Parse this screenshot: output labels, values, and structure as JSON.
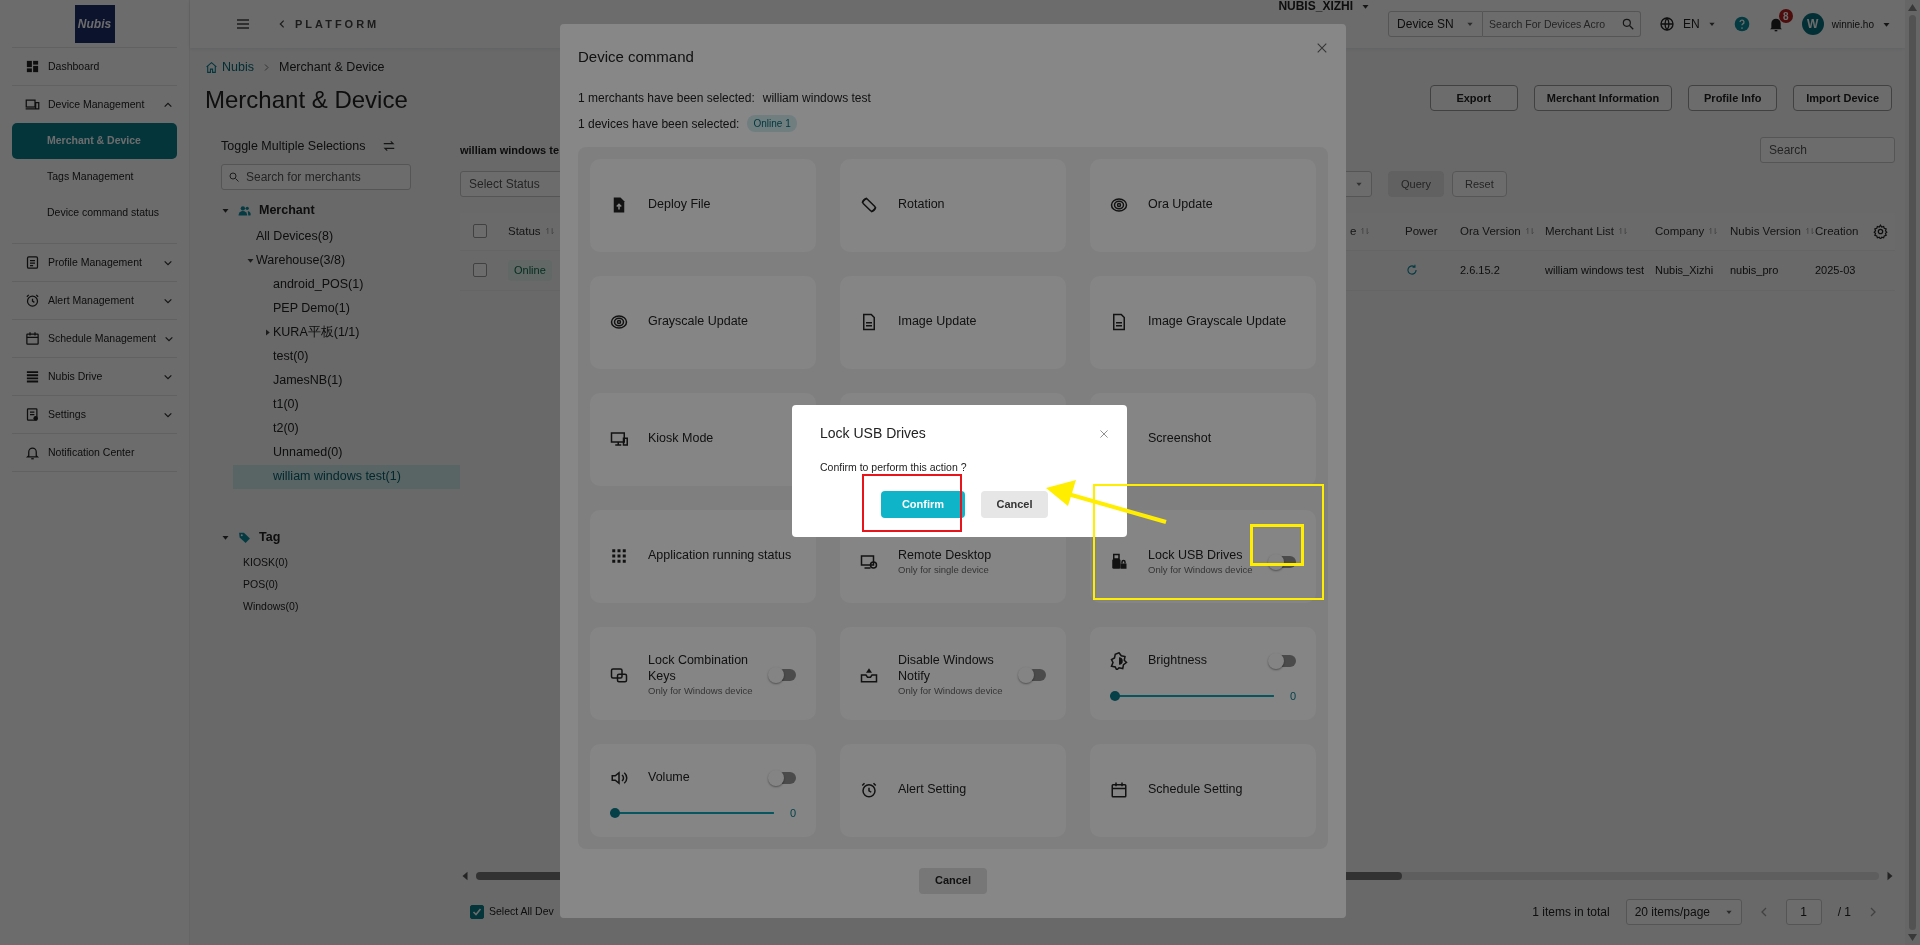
{
  "sidebar": {
    "logo": "Nubis",
    "items": [
      {
        "label": "Dashboard"
      },
      {
        "label": "Device Management",
        "expanded": true,
        "children": [
          {
            "label": "Merchant & Device",
            "selected": true
          },
          {
            "label": "Tags Management",
            "selected": false
          },
          {
            "label": "Device command status",
            "selected": false
          }
        ]
      },
      {
        "label": "Profile Management",
        "expanded": false
      },
      {
        "label": "Alert Management",
        "expanded": false
      },
      {
        "label": "Schedule Management",
        "expanded": false
      },
      {
        "label": "Nubis Drive",
        "expanded": false
      },
      {
        "label": "Settings",
        "expanded": false
      },
      {
        "label": "Notification Center"
      }
    ]
  },
  "header": {
    "platform": "PLATFORM",
    "merchant": "NUBIS_XIZHI",
    "search_type": "Device SN",
    "search_placeholder": "Search For Devices Acro",
    "language": "EN",
    "notification_count": "8",
    "avatar": "W",
    "user": "winnie.ho"
  },
  "breadcrumb": [
    "Nubis",
    "Merchant & Device"
  ],
  "page_title": "Merchant & Device",
  "actions": [
    "Export",
    "Merchant Information",
    "Profile Info",
    "Import Device"
  ],
  "tree_panel": {
    "toggle_label": "Toggle Multiple Selections",
    "search_placeholder": "Search for merchants",
    "groups": [
      {
        "kind": "merchant",
        "label": "Merchant",
        "expanded": true,
        "children": [
          {
            "label": "All Devices(8)",
            "selected": false
          },
          {
            "label": "Warehouse(3/8)",
            "selected": false,
            "expanded": true,
            "children": [
              {
                "label": "android_POS(1)",
                "selected": false
              },
              {
                "label": "PEP Demo(1)",
                "selected": false
              },
              {
                "label": "KURA平板(1/1)",
                "selected": false,
                "expanded": false
              },
              {
                "label": "test(0)",
                "selected": false
              },
              {
                "label": "JamesNB(1)",
                "selected": false
              },
              {
                "label": "t1(0)",
                "selected": false
              },
              {
                "label": "t2(0)",
                "selected": false
              },
              {
                "label": "Unnamed(0)",
                "selected": false
              },
              {
                "label": "william windows test(1)",
                "selected": true
              }
            ]
          }
        ]
      },
      {
        "kind": "tag",
        "label": "Tag",
        "expanded": true,
        "children": [
          {
            "label": "KIOSK(0)",
            "selected": false
          },
          {
            "label": "POS(0)",
            "selected": false
          },
          {
            "label": "Windows(0)",
            "selected": false
          }
        ]
      }
    ]
  },
  "device_list": {
    "title": "william windows te",
    "search_placeholder": "Search",
    "status_placeholder": "Select Status",
    "buttons": [
      {
        "label": "Query",
        "kind": "filled"
      },
      {
        "label": "Reset",
        "kind": "outline"
      }
    ],
    "table": {
      "header_checked": false,
      "columns": [
        {
          "label": "Status",
          "sortable": true
        },
        {
          "label": "e",
          "sortable": true
        },
        {
          "label": "Power",
          "sortable": false
        },
        {
          "label": "Ora Version",
          "sortable": true
        },
        {
          "label": "Merchant List",
          "sortable": true
        },
        {
          "label": "Company",
          "sortable": true
        },
        {
          "label": "Nubis Version",
          "sortable": true
        },
        {
          "label": "Creation",
          "sortable": false
        }
      ],
      "rows": [
        {
          "checked": false,
          "status": "Online",
          "ora_version": "2.6.15.2",
          "merchant_list": "william windows test",
          "company": "Nubis_Xizhi",
          "nubis_version": "nubis_pro",
          "creation": "2025-03"
        }
      ]
    },
    "select_all": {
      "label": "Select All Dev",
      "checked": true
    },
    "pagination": {
      "total": "1 items in total",
      "page_size": "20 items/page",
      "page": "1",
      "pages": "/ 1"
    }
  },
  "device_command": {
    "title": "Device command",
    "merchants_label": "1 merchants have been selected:",
    "merchants_value": "william windows test",
    "devices_label": "1 devices have been selected:",
    "devices_badge": "Online 1",
    "commands": [
      {
        "kind": "action",
        "label": "Deploy File"
      },
      {
        "kind": "action",
        "label": "Rotation"
      },
      {
        "kind": "action",
        "label": "Ora Update"
      },
      {
        "kind": "action",
        "label": "Grayscale Update"
      },
      {
        "kind": "action",
        "label": "Image Update"
      },
      {
        "kind": "action",
        "label": "Image Grayscale Update"
      },
      {
        "kind": "action",
        "label": "Kiosk Mode"
      },
      {
        "kind": "action"
      },
      {
        "kind": "action",
        "label": "Screenshot"
      },
      {
        "kind": "action",
        "label": "Application running status"
      },
      {
        "kind": "action",
        "label": "Remote Desktop",
        "note": "Only for single device"
      },
      {
        "kind": "toggle",
        "label": "Lock USB Drives",
        "note": "Only for Windows device",
        "on": false
      },
      {
        "kind": "toggle",
        "label": "Lock Combination Keys",
        "note": "Only for Windows device",
        "on": false
      },
      {
        "kind": "toggle",
        "label": "Disable Windows Notify",
        "note": "Only for Windows device",
        "on": false
      },
      {
        "kind": "slider",
        "label": "Brightness",
        "on": false,
        "level": 0,
        "reading": "0"
      },
      {
        "kind": "slider",
        "label": "Volume",
        "on": false,
        "level": 0,
        "reading": "0"
      },
      {
        "kind": "action",
        "label": "Alert Setting"
      },
      {
        "kind": "action",
        "label": "Schedule Setting"
      }
    ],
    "cancel": "Cancel"
  },
  "confirm_dialog": {
    "title": "Lock USB Drives",
    "message": "Confirm to perform this action ?",
    "confirm": "Confirm",
    "cancel": "Cancel"
  }
}
